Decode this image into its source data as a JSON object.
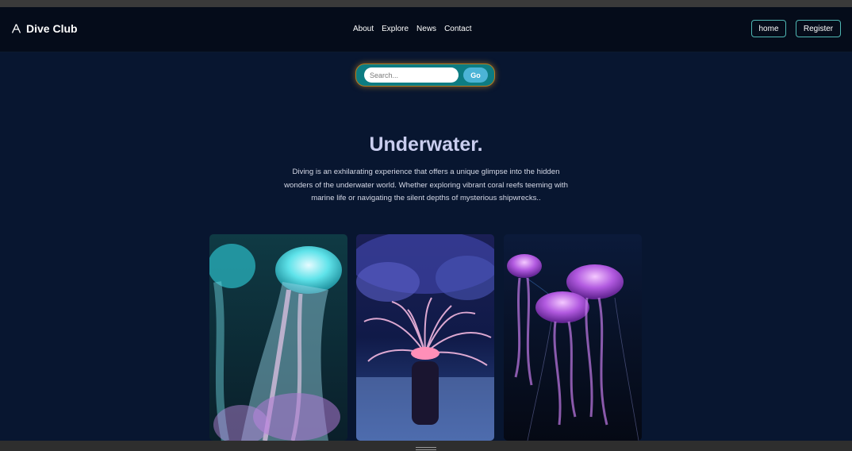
{
  "nav": {
    "brand": "Dive Club",
    "brand_icon": "triangle-logo-icon",
    "links": [
      "About",
      "Explore",
      "News",
      "Contact"
    ],
    "home_label": "home",
    "register_label": "Register"
  },
  "search": {
    "placeholder": "Search...",
    "value": "",
    "go_label": "Go"
  },
  "hero": {
    "title": "Underwater.",
    "description": "Diving is an exhilarating experience that offers a unique glimpse into the hidden wonders of the underwater world. Whether exploring vibrant coral reefs teeming with marine life or navigating the silent depths of mysterious shipwrecks.."
  },
  "gallery": [
    {
      "subject": "teal and violet jellyfish"
    },
    {
      "subject": "pink sea anemone on coral reef"
    },
    {
      "subject": "purple jellyfish in dark water"
    }
  ],
  "colors": {
    "background": "#081630",
    "nav_background": "#050c1a",
    "accent_teal": "#0d7c82",
    "go_button": "#4cb4d6",
    "title": "#c9cdee",
    "button_border": "#4fb7b4"
  }
}
